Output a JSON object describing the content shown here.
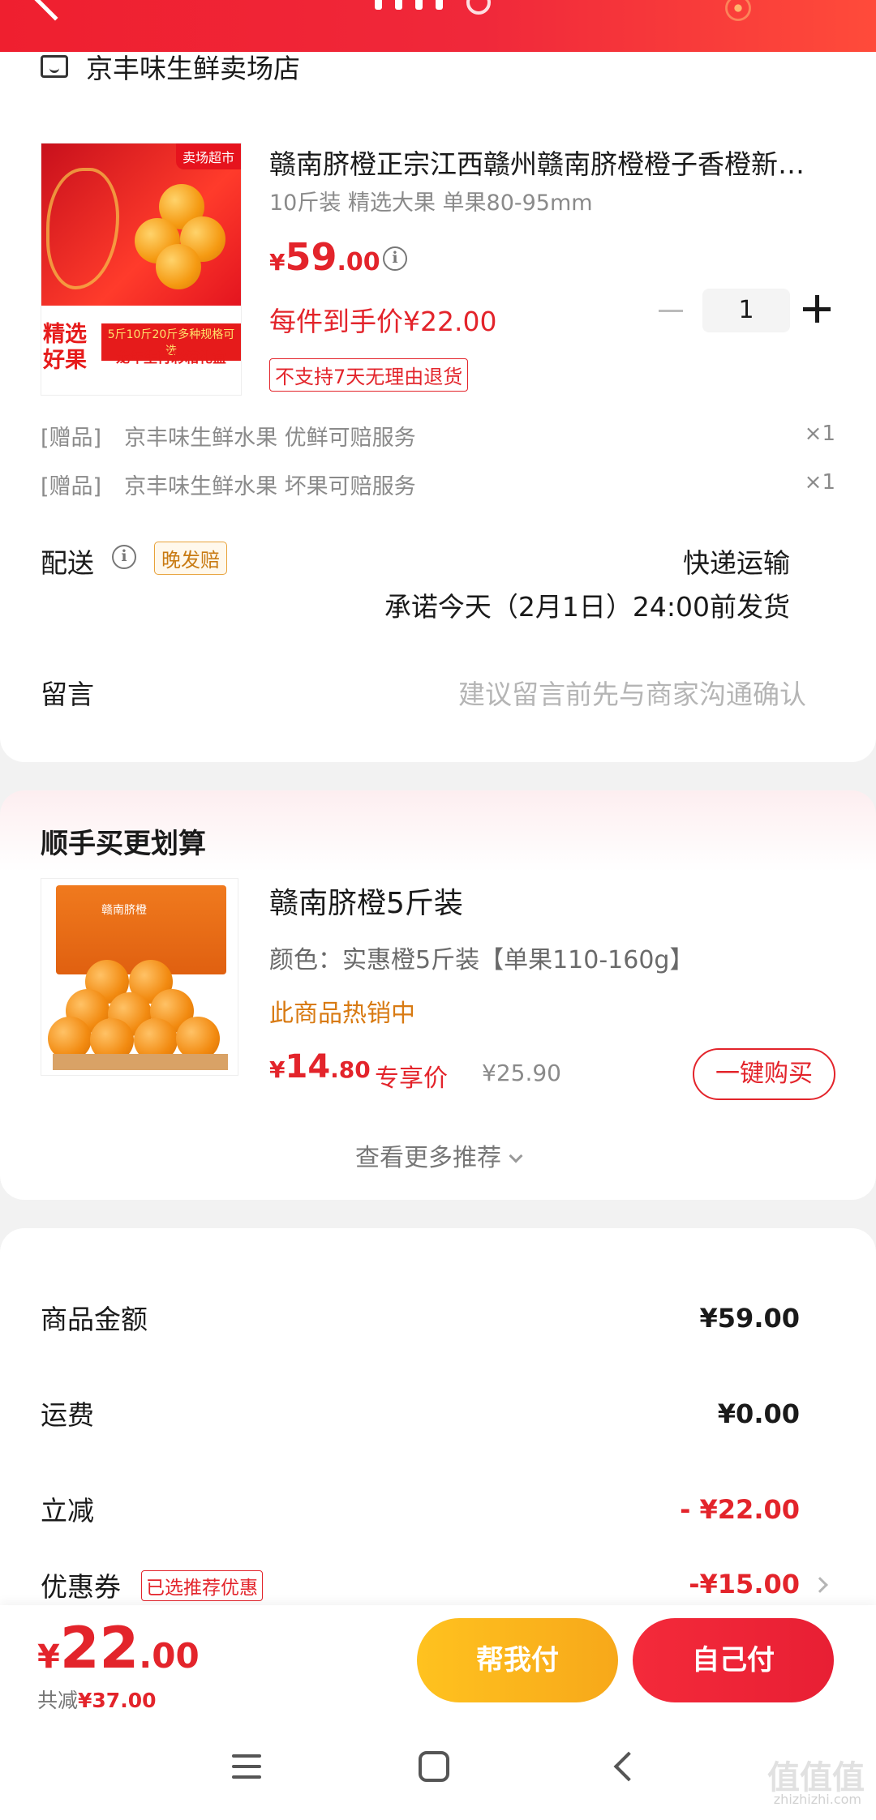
{
  "store": {
    "name": "京丰味生鲜卖场店"
  },
  "product": {
    "title": "赣南脐橙正宗江西赣州赣南脐橙橙子香橙新鲜当季水果",
    "subtitle": "10斤装 精选大果 单果80-95mm",
    "price_currency": "¥",
    "price_int": "59",
    "price_dec": ".00",
    "quantity": "1",
    "hand_price": "每件到手价¥22.00",
    "no_return_tag": "不支持7天无理由退货",
    "image_tag": "卖场超市",
    "image_text_select": "精选好果",
    "image_text_spec": "5斤10斤20斤多种规格可选",
    "image_text_box": "龙年生肖彩箱礼盒"
  },
  "gifts": [
    {
      "bracket": "[赠品]",
      "label": "京丰味生鲜水果 优鲜可赔服务",
      "qty": "×1"
    },
    {
      "bracket": "[赠品]",
      "label": "京丰味生鲜水果 坏果可赔服务",
      "qty": "×1"
    }
  ],
  "delivery": {
    "label": "配送",
    "late_tag": "晚发赔",
    "method": "快递运输",
    "promise": "承诺今天（2月1日）24:00前发货"
  },
  "message": {
    "label": "留言",
    "placeholder": "建议留言前先与商家沟通确认"
  },
  "recommend": {
    "section_title": "顺手买更划算",
    "title": "赣南脐橙5斤装",
    "color": "颜色：实惠橙5斤装【单果110-160g】",
    "hot": "此商品热销中",
    "price_currency": "¥",
    "price_int": "14",
    "price_dec": ".80",
    "exclusive": "专享价",
    "original": "¥25.90",
    "buy_button": "一键购买",
    "more": "查看更多推荐",
    "box_text": "赣南脐橙"
  },
  "summary": {
    "goods_label": "商品金额",
    "goods_value": "¥59.00",
    "freight_label": "运费",
    "freight_value": "¥0.00",
    "discount_label": "立减",
    "discount_value": "- ¥22.00",
    "coupon_label": "优惠券",
    "coupon_tag": "已选推荐优惠",
    "coupon_value": "-¥15.00"
  },
  "paybar": {
    "total_currency": "¥",
    "total_int": "22",
    "total_dec": ".00",
    "saved_prefix": "共减",
    "saved_value": "¥37.00",
    "help_pay": "帮我付",
    "self_pay": "自己付"
  },
  "watermark": {
    "mark": "值值值",
    "site": "zhizhizhi.com"
  },
  "colors": {
    "accent_red": "#e3242b",
    "help_yellow": "#ffc21f",
    "header_red": "#ef1f2f"
  }
}
